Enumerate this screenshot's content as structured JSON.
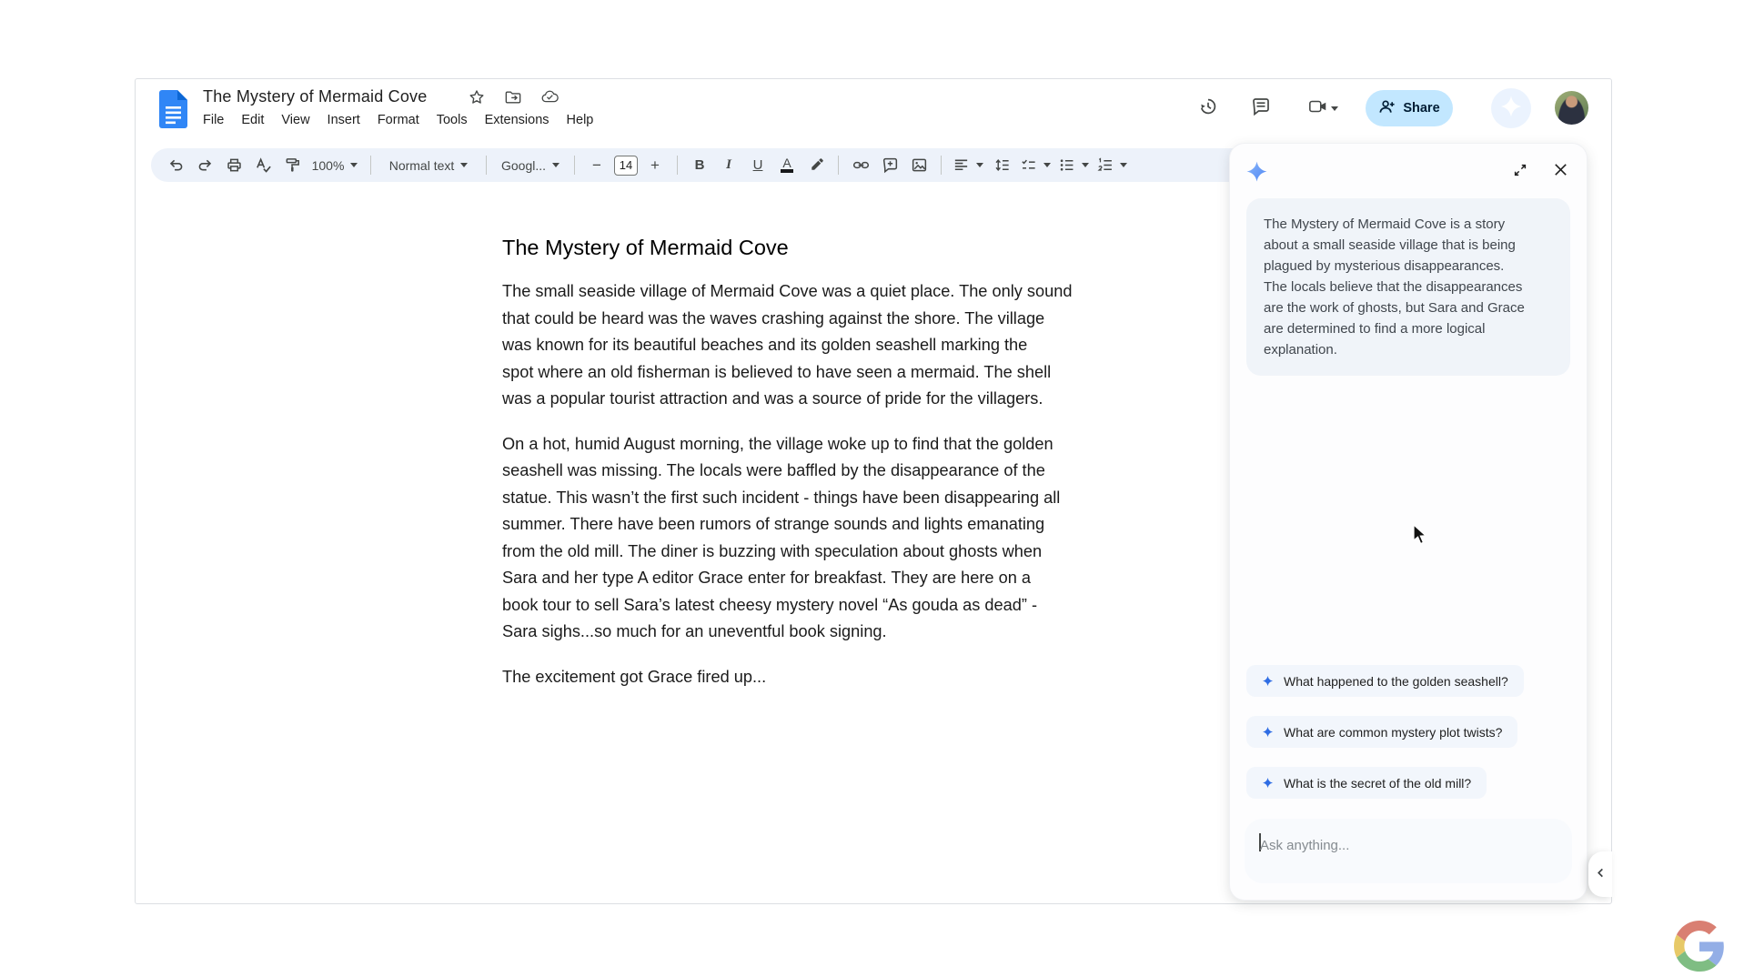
{
  "window": {
    "doc_title": "The Mystery of Mermaid Cove",
    "menu_items": [
      "File",
      "Edit",
      "View",
      "Insert",
      "Format",
      "Tools",
      "Extensions",
      "Help"
    ],
    "share_label": "Share"
  },
  "toolbar": {
    "zoom_value": "100%",
    "styles_value": "Normal text",
    "font_value": "Googl...",
    "font_size_value": "14",
    "decrease_label": "−",
    "increase_label": "+",
    "bold_label": "B",
    "italic_label": "I",
    "underline_label": "U",
    "text_color_label": "A"
  },
  "document": {
    "title": "The Mystery of Mermaid Cove",
    "paragraphs": [
      "The small seaside village of Mermaid Cove was a quiet place. The only sound\nthat could be heard was the waves crashing against the shore. The village\nwas known for its beautiful beaches and its golden seashell marking the\nspot where an old fisherman is believed to have seen a mermaid. The shell\nwas a popular tourist attraction and was a source of pride for the villagers.",
      "On a hot, humid August morning, the village woke up to find that the golden\nseashell was missing. The locals were baffled by the disappearance of the\nstatue. This wasn’t the first such incident - things have been disappearing all\nsummer. There have been rumors of strange sounds and lights emanating\nfrom the old mill. The diner is buzzing with speculation about ghosts when\nSara and her type A editor Grace enter for breakfast. They are here on a\nbook tour to sell Sara’s latest cheesy mystery novel “As gouda as dead” -\nSara sighs...so much for an uneventful book signing.",
      "The excitement got Grace fired up..."
    ]
  },
  "gemini_panel": {
    "summary": "The Mystery of Mermaid Cove is a story\nabout a small seaside village that is being\nplagued by mysterious disappearances.\nThe locals believe that the disappearances\nare the work of ghosts, but Sara and Grace\nare determined to find a more logical\nexplanation.",
    "suggestions": [
      "What happened to the golden seashell?",
      "What are common mystery plot twists?",
      "What is the secret of the old mill?"
    ],
    "input_placeholder": "Ask anything...",
    "accent_color": "#4e86f5"
  }
}
